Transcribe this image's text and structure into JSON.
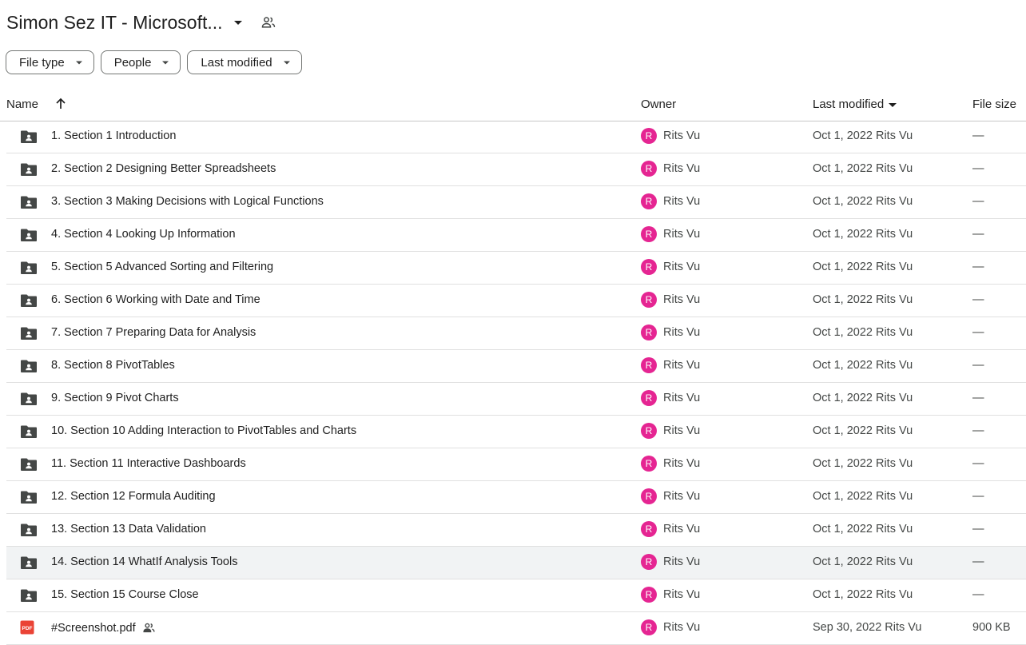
{
  "header": {
    "title": "Simon Sez IT - Microsoft...",
    "title_caret_icon": "arrow-drop-down-icon",
    "shared_icon": "people-icon"
  },
  "filters": [
    {
      "label": "File type"
    },
    {
      "label": "People"
    },
    {
      "label": "Last modified"
    }
  ],
  "table": {
    "columns": {
      "name": "Name",
      "owner": "Owner",
      "modified": "Last modified",
      "size": "File size"
    },
    "rows": [
      {
        "name": "1. Section 1 Introduction",
        "type": "shared-folder",
        "owner": "Rits Vu",
        "avatar": "R",
        "modified": "Oct 1, 2022",
        "modified_by": "Rits Vu",
        "size": "—"
      },
      {
        "name": "2. Section 2 Designing Better Spreadsheets",
        "type": "shared-folder",
        "owner": "Rits Vu",
        "avatar": "R",
        "modified": "Oct 1, 2022",
        "modified_by": "Rits Vu",
        "size": "—"
      },
      {
        "name": "3. Section 3 Making Decisions with Logical Functions",
        "type": "shared-folder",
        "owner": "Rits Vu",
        "avatar": "R",
        "modified": "Oct 1, 2022",
        "modified_by": "Rits Vu",
        "size": "—"
      },
      {
        "name": "4. Section 4 Looking Up Information",
        "type": "shared-folder",
        "owner": "Rits Vu",
        "avatar": "R",
        "modified": "Oct 1, 2022",
        "modified_by": "Rits Vu",
        "size": "—"
      },
      {
        "name": "5. Section 5 Advanced Sorting and Filtering",
        "type": "shared-folder",
        "owner": "Rits Vu",
        "avatar": "R",
        "modified": "Oct 1, 2022",
        "modified_by": "Rits Vu",
        "size": "—"
      },
      {
        "name": "6. Section 6 Working with Date and Time",
        "type": "shared-folder",
        "owner": "Rits Vu",
        "avatar": "R",
        "modified": "Oct 1, 2022",
        "modified_by": "Rits Vu",
        "size": "—"
      },
      {
        "name": "7. Section 7 Preparing Data for Analysis",
        "type": "shared-folder",
        "owner": "Rits Vu",
        "avatar": "R",
        "modified": "Oct 1, 2022",
        "modified_by": "Rits Vu",
        "size": "—"
      },
      {
        "name": "8. Section 8 PivotTables",
        "type": "shared-folder",
        "owner": "Rits Vu",
        "avatar": "R",
        "modified": "Oct 1, 2022",
        "modified_by": "Rits Vu",
        "size": "—"
      },
      {
        "name": "9. Section 9 Pivot Charts",
        "type": "shared-folder",
        "owner": "Rits Vu",
        "avatar": "R",
        "modified": "Oct 1, 2022",
        "modified_by": "Rits Vu",
        "size": "—"
      },
      {
        "name": "10. Section 10 Adding Interaction to PivotTables and Charts",
        "type": "shared-folder",
        "owner": "Rits Vu",
        "avatar": "R",
        "modified": "Oct 1, 2022",
        "modified_by": "Rits Vu",
        "size": "—"
      },
      {
        "name": "11. Section 11 Interactive Dashboards",
        "type": "shared-folder",
        "owner": "Rits Vu",
        "avatar": "R",
        "modified": "Oct 1, 2022",
        "modified_by": "Rits Vu",
        "size": "—"
      },
      {
        "name": "12. Section 12 Formula Auditing",
        "type": "shared-folder",
        "owner": "Rits Vu",
        "avatar": "R",
        "modified": "Oct 1, 2022",
        "modified_by": "Rits Vu",
        "size": "—"
      },
      {
        "name": "13. Section 13 Data Validation",
        "type": "shared-folder",
        "owner": "Rits Vu",
        "avatar": "R",
        "modified": "Oct 1, 2022",
        "modified_by": "Rits Vu",
        "size": "—"
      },
      {
        "name": "14. Section 14 WhatIf Analysis Tools",
        "type": "shared-folder",
        "owner": "Rits Vu",
        "avatar": "R",
        "modified": "Oct 1, 2022",
        "modified_by": "Rits Vu",
        "size": "—",
        "highlighted": true
      },
      {
        "name": "15. Section 15 Course Close",
        "type": "shared-folder",
        "owner": "Rits Vu",
        "avatar": "R",
        "modified": "Oct 1, 2022",
        "modified_by": "Rits Vu",
        "size": "—"
      },
      {
        "name": "#Screenshot.pdf",
        "type": "pdf",
        "shared": true,
        "owner": "Rits Vu",
        "avatar": "R",
        "modified": "Sep 30, 2022",
        "modified_by": "Rits Vu",
        "size": "900 KB"
      }
    ]
  },
  "colors": {
    "avatar": "#e52592",
    "folder_icon": "#444746",
    "pdf_icon": "#ea4335",
    "row_highlight": "#f1f3f4"
  }
}
